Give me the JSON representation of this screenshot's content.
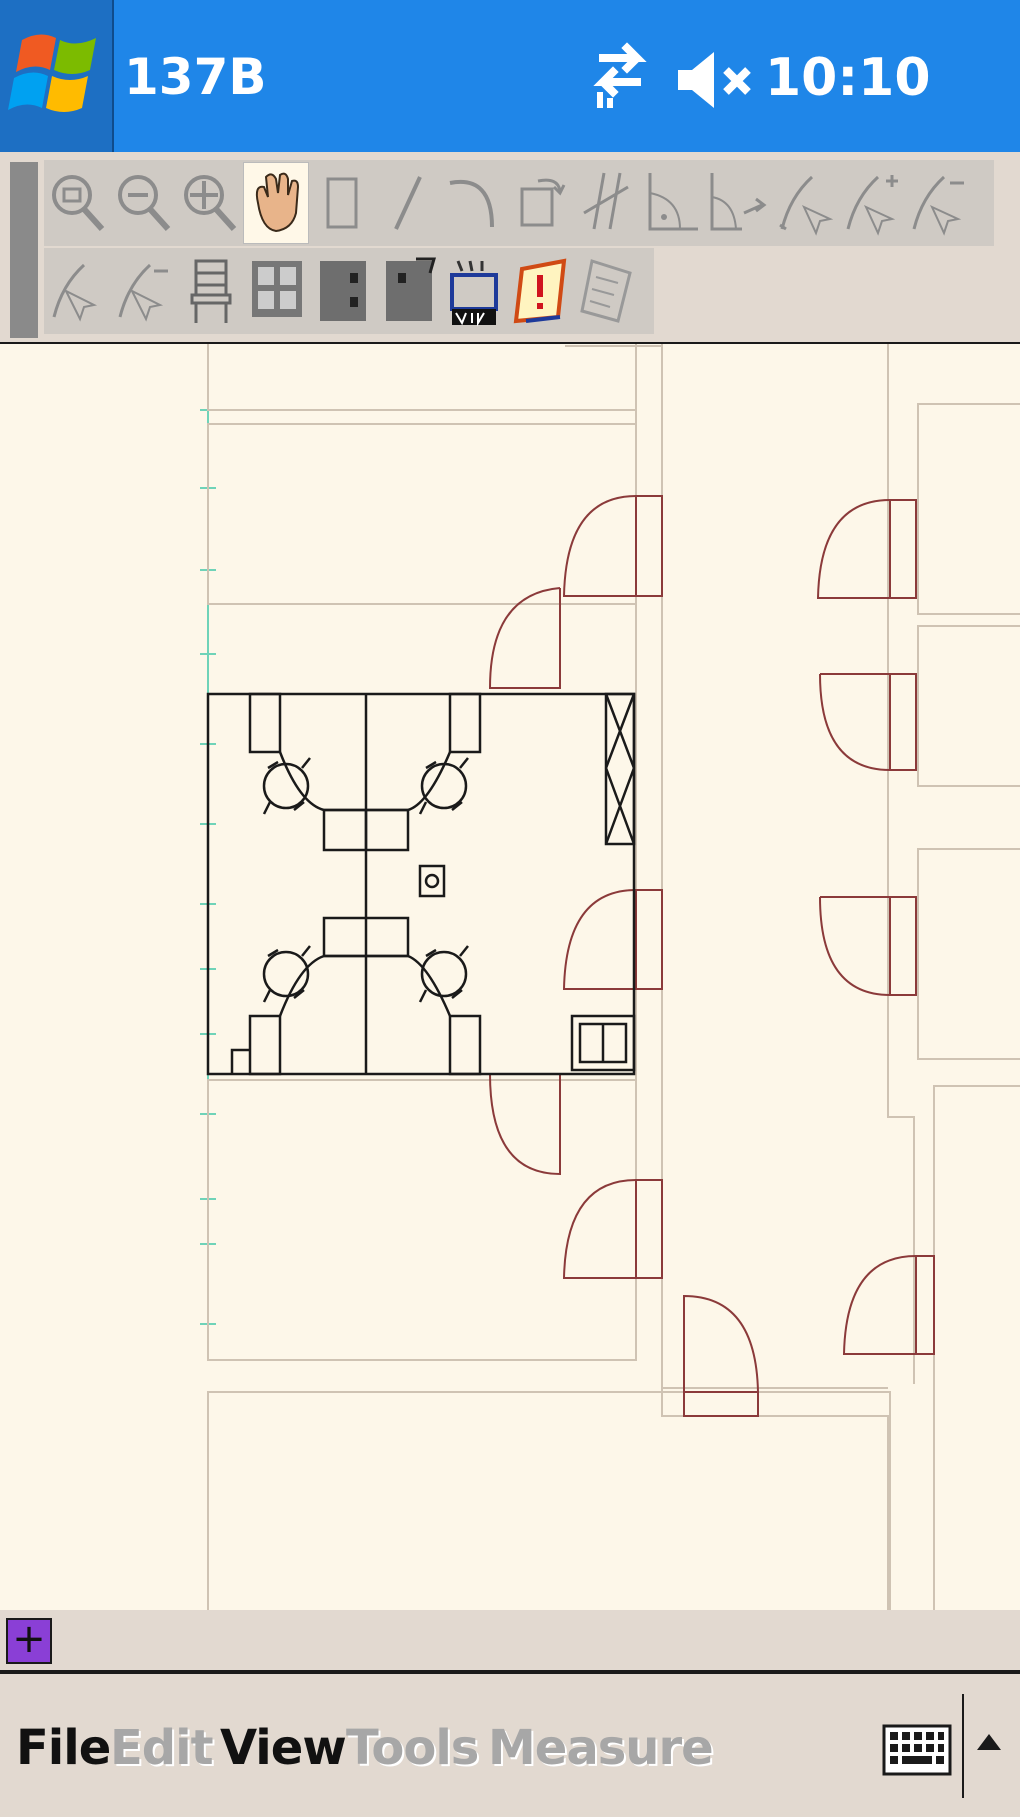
{
  "titlebar": {
    "app_title": "137B",
    "clock": "10:10",
    "bg_color": "#1f86e8"
  },
  "toolbar": {
    "row1": [
      "zoom-window-icon",
      "zoom-out-icon",
      "zoom-extents-icon",
      "pan-hand-icon",
      "rectangle-icon",
      "line-icon",
      "arc-icon",
      "rotate-icon",
      "trim-icon",
      "angle-icon",
      "angle-arrow-icon",
      "measure-icon",
      "measure-add-icon",
      "measure-remove-icon"
    ],
    "row2": [
      "markup-icon",
      "markup-remove-icon",
      "chair-icon",
      "furniture-icon",
      "cabinet-icon",
      "cabinet-tag-icon",
      "equipment-icon",
      "alert-tag-icon",
      "note-icon"
    ],
    "active": "pan-hand-icon"
  },
  "statusbar": {
    "add_label": "+"
  },
  "menubar": {
    "items": [
      {
        "label": "File",
        "enabled": true
      },
      {
        "label": "Edit",
        "enabled": false
      },
      {
        "label": "View",
        "enabled": true
      },
      {
        "label": "Tools",
        "enabled": false
      },
      {
        "label": "Measure",
        "enabled": false
      }
    ]
  },
  "colors": {
    "door": "#8b3a3a",
    "wall": "#cfc3b3",
    "furniture": "#1a1a1a",
    "grid": "#6fd3b8"
  }
}
